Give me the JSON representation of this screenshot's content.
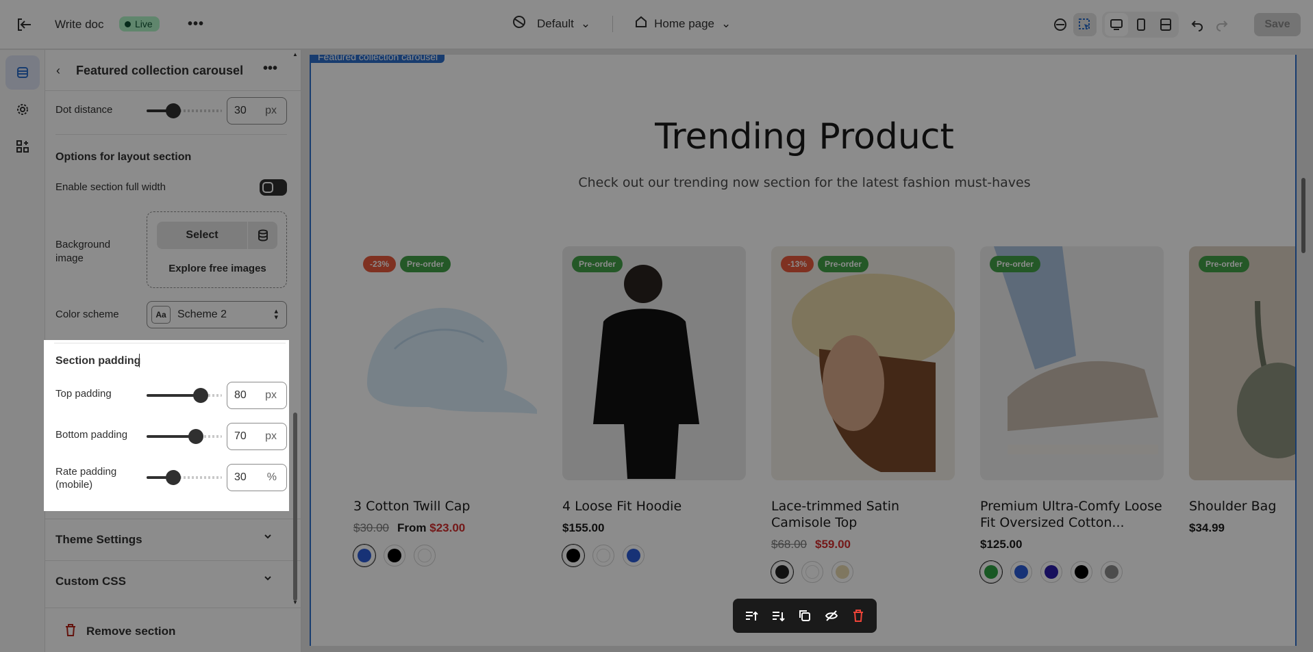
{
  "header": {
    "title": "Write doc",
    "status": "Live",
    "theme_selector": "Default",
    "page_selector": "Home page",
    "save_label": "Save"
  },
  "panel": {
    "title": "Featured collection carousel",
    "dot_distance": {
      "label": "Dot distance",
      "value": "30",
      "unit": "px",
      "fraction": 0.35
    },
    "layout_heading": "Options for layout section",
    "full_width_label": "Enable section full width",
    "full_width_on": true,
    "background": {
      "label": "Background image",
      "select": "Select",
      "explore": "Explore free images"
    },
    "color_scheme": {
      "label": "Color scheme",
      "icon_text": "Aa",
      "value": "Scheme 2"
    },
    "padding": {
      "heading": "Section padding",
      "top": {
        "label": "Top padding",
        "value": "80",
        "unit": "px",
        "fraction": 0.72
      },
      "bottom": {
        "label": "Bottom padding",
        "value": "70",
        "unit": "px",
        "fraction": 0.65
      },
      "rate": {
        "label": "Rate padding (mobile)",
        "value": "30",
        "unit": "%",
        "fraction": 0.35
      }
    },
    "theme_settings": "Theme Settings",
    "custom_css": "Custom CSS",
    "remove_section": "Remove section"
  },
  "preview": {
    "section_tag": "Featured collection carousel",
    "heading": "Trending Product",
    "subheading": "Check out our trending now section for the latest fashion must-haves",
    "products": [
      {
        "name": "3 Cotton Twill Cap",
        "badges": [
          "-23%",
          "Pre-order"
        ],
        "old_price": "$30.00",
        "from": "From",
        "price": "$23.00",
        "swatches": [
          "#2a5bd7",
          "#000000",
          "#ffffff"
        ]
      },
      {
        "name": "4 Loose Fit Hoodie",
        "badges": [
          "Pre-order"
        ],
        "old_price": "",
        "from": "",
        "price": "$155.00",
        "swatches": [
          "#000000",
          "#ffffff",
          "#2a5bd7"
        ]
      },
      {
        "name": "Lace-trimmed Satin Camisole Top",
        "badges": [
          "-13%",
          "Pre-order"
        ],
        "old_price": "$68.00",
        "from": "",
        "price": "$59.00",
        "swatches": [
          "#222222",
          "#ffffff",
          "#e8d9b0"
        ]
      },
      {
        "name": "Premium Ultra-Comfy Loose Fit Oversized Cotton...",
        "badges": [
          "Pre-order"
        ],
        "old_price": "",
        "from": "",
        "price": "$125.00",
        "swatches": [
          "#2ea043",
          "#2a5bd7",
          "#2b1ca8",
          "#000000",
          "#8a8a8a"
        ]
      },
      {
        "name": "Shoulder Bag",
        "badges": [
          "Pre-order"
        ],
        "old_price": "",
        "from": "",
        "price": "$34.99",
        "swatches": []
      }
    ]
  }
}
